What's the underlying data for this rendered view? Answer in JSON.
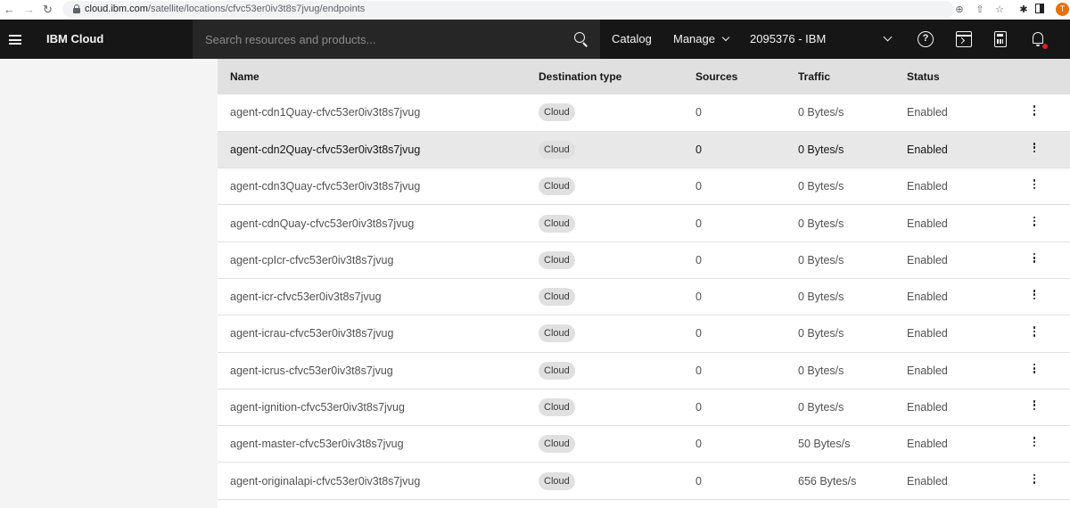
{
  "browser": {
    "url_host": "cloud.ibm.com",
    "url_path": "/satellite/locations/cfvc53er0iv3t8s7jvug/endpoints",
    "profile_initial": "T",
    "icons": [
      "back-arrow-icon",
      "forward-arrow-icon",
      "reload-icon",
      "lock-icon",
      "zoom-icon",
      "share-icon",
      "star-icon",
      "extensions-icon",
      "sidebar-icon"
    ]
  },
  "header": {
    "brand": "IBM Cloud",
    "search_placeholder": "Search resources and products...",
    "catalog": "Catalog",
    "manage": "Manage",
    "account": "2095376 - IBM",
    "icons": [
      "menu-icon",
      "search-icon",
      "help-icon",
      "docs-icon",
      "cost-estimator-icon",
      "notifications-icon"
    ],
    "colors": {
      "header_bg": "#161616",
      "search_bg": "#262626",
      "notification_dot": "#da1e28"
    }
  },
  "table": {
    "columns": [
      "Name",
      "Destination type",
      "Sources",
      "Traffic",
      "Status"
    ],
    "rows": [
      {
        "name": "agent-cdn1Quay-cfvc53er0iv3t8s7jvug",
        "type": "Cloud",
        "sources": "0",
        "traffic": "0 Bytes/s",
        "status": "Enabled"
      },
      {
        "name": "agent-cdn2Quay-cfvc53er0iv3t8s7jvug",
        "type": "Cloud",
        "sources": "0",
        "traffic": "0 Bytes/s",
        "status": "Enabled"
      },
      {
        "name": "agent-cdn3Quay-cfvc53er0iv3t8s7jvug",
        "type": "Cloud",
        "sources": "0",
        "traffic": "0 Bytes/s",
        "status": "Enabled"
      },
      {
        "name": "agent-cdnQuay-cfvc53er0iv3t8s7jvug",
        "type": "Cloud",
        "sources": "0",
        "traffic": "0 Bytes/s",
        "status": "Enabled"
      },
      {
        "name": "agent-cpIcr-cfvc53er0iv3t8s7jvug",
        "type": "Cloud",
        "sources": "0",
        "traffic": "0 Bytes/s",
        "status": "Enabled"
      },
      {
        "name": "agent-icr-cfvc53er0iv3t8s7jvug",
        "type": "Cloud",
        "sources": "0",
        "traffic": "0 Bytes/s",
        "status": "Enabled"
      },
      {
        "name": "agent-icrau-cfvc53er0iv3t8s7jvug",
        "type": "Cloud",
        "sources": "0",
        "traffic": "0 Bytes/s",
        "status": "Enabled"
      },
      {
        "name": "agent-icrus-cfvc53er0iv3t8s7jvug",
        "type": "Cloud",
        "sources": "0",
        "traffic": "0 Bytes/s",
        "status": "Enabled"
      },
      {
        "name": "agent-ignition-cfvc53er0iv3t8s7jvug",
        "type": "Cloud",
        "sources": "0",
        "traffic": "0 Bytes/s",
        "status": "Enabled"
      },
      {
        "name": "agent-master-cfvc53er0iv3t8s7jvug",
        "type": "Cloud",
        "sources": "0",
        "traffic": "50 Bytes/s",
        "status": "Enabled"
      },
      {
        "name": "agent-originalapi-cfvc53er0iv3t8s7jvug",
        "type": "Cloud",
        "sources": "0",
        "traffic": "656 Bytes/s",
        "status": "Enabled"
      }
    ],
    "hovered_row": 1,
    "row_action_icon": "overflow-menu-icon"
  }
}
